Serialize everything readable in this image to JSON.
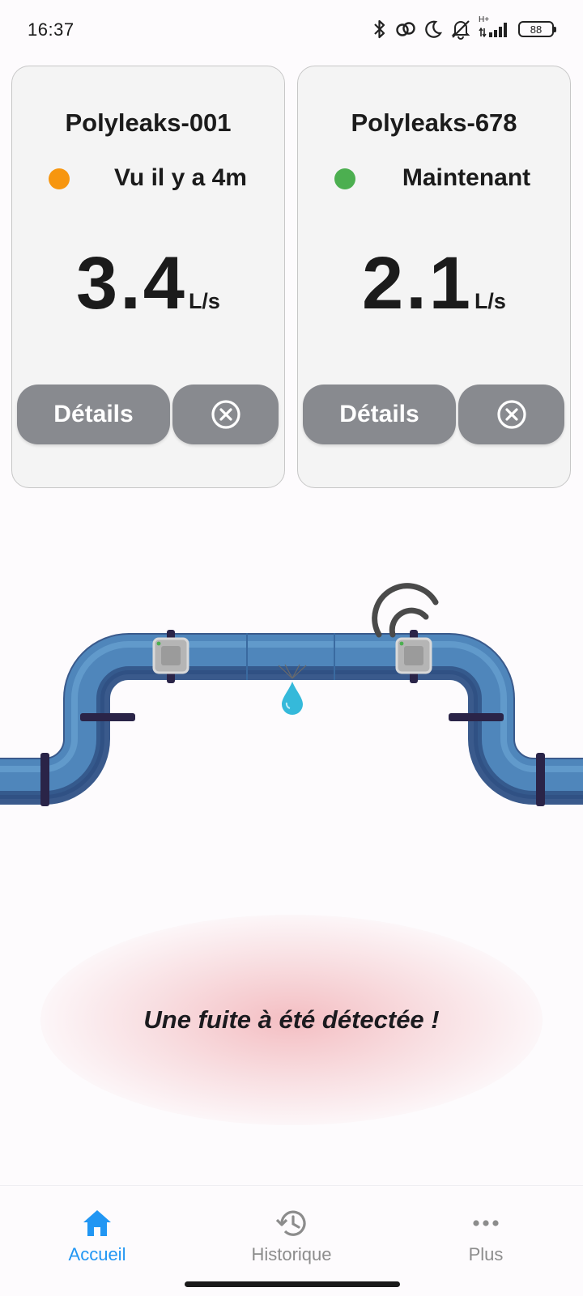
{
  "status_bar": {
    "time": "16:37",
    "network_label": "H+",
    "battery": "88"
  },
  "devices": [
    {
      "name": "Polyleaks-001",
      "status": "Vu il y a 4m",
      "status_color": "#f7960f",
      "flow": "3.4",
      "unit": "L/s",
      "details_label": "Détails"
    },
    {
      "name": "Polyleaks-678",
      "status": "Maintenant",
      "status_color": "#4caf50",
      "flow": "2.1",
      "unit": "L/s",
      "details_label": "Détails"
    }
  ],
  "alert": {
    "message": "Une fuite à été détectée !"
  },
  "nav": {
    "home": "Accueil",
    "history": "Historique",
    "more": "Plus",
    "active_color": "#2196f3",
    "inactive_color": "#8c8c8c"
  },
  "icons": {
    "close": "close-circle-icon",
    "home": "home-icon",
    "history": "history-icon",
    "more": "more-horizontal-icon",
    "signal": "wifi-signal-icon",
    "leak": "water-drop-icon"
  }
}
